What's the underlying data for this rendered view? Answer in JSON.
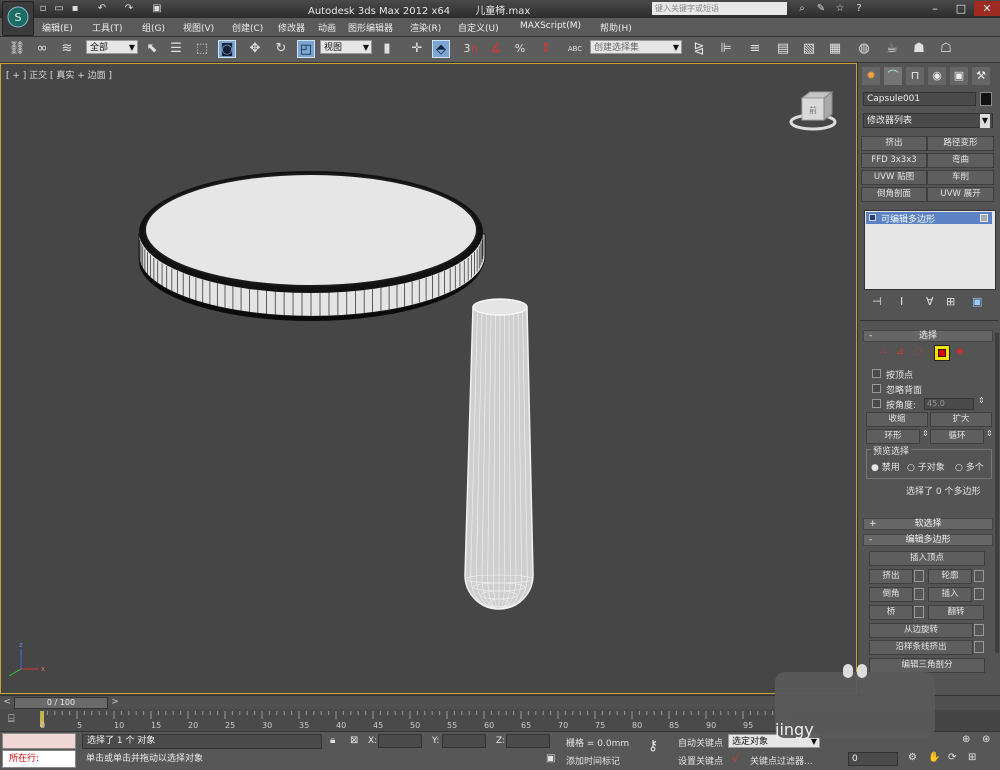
{
  "title_bar": {
    "app": "Autodesk 3ds Max  2012 x64",
    "file": "儿童椅.max",
    "search_placeholder": "键入关键字或短语"
  },
  "menu": [
    "编辑(E)",
    "工具(T)",
    "组(G)",
    "视图(V)",
    "创建(C)",
    "修改器",
    "动画",
    "图形编辑器",
    "渲染(R)",
    "自定义(U)",
    "MAXScript(M)",
    "帮助(H)"
  ],
  "toolbar": {
    "selection_filter": "全部",
    "reference_coord": "视图",
    "named_selection": "创建选择集",
    "snap_labels": [
      "3",
      "%",
      "ABC"
    ]
  },
  "viewport": {
    "label": "[ + ] 正交  [ 真实 + 边面 ]",
    "nav_cube_label": "前"
  },
  "panel": {
    "object_name": "Capsule001",
    "modifier_list": "修改器列表",
    "quick_modifiers": [
      "挤出",
      "路径变形",
      "FFD 3x3x3",
      "弯曲",
      "UVW 贴图",
      "车削",
      "倒角剖面",
      "UVW 展开"
    ],
    "stack_item": "可编辑多边形",
    "selection_rollout": "选择",
    "by_vertex": "按顶点",
    "ignore_backfacing": "忽略背面",
    "by_angle": "按角度:",
    "angle_value": "45.0",
    "shrink": "收缩",
    "grow": "扩大",
    "ring": "环形",
    "loop": "循环",
    "preview_group": "预览选择",
    "preview_options": [
      "禁用",
      "子对象",
      "多个"
    ],
    "selection_status": "选择了 0 个多边形",
    "soft_selection": "软选择",
    "edit_polygons": "编辑多边形",
    "insert_vertex": "插入顶点",
    "edit_buttons": [
      "挤出",
      "轮廓",
      "倒角",
      "插入",
      "桥",
      "翻转"
    ],
    "hinge": "从边旋转",
    "extrude_spline": "沿样条线挤出",
    "edit_triangulation": "编辑三角剖分"
  },
  "timeline": {
    "frame": "0 / 100",
    "ticks": [
      "0",
      "5",
      "10",
      "15",
      "20",
      "25",
      "30",
      "35",
      "40",
      "45",
      "50",
      "55",
      "60",
      "65",
      "70",
      "75",
      "80",
      "85",
      "90",
      "95"
    ]
  },
  "status": {
    "running": "所在行:",
    "selected": "选择了 1 个 对象",
    "prompt": "单击或单击并拖动以选择对象",
    "x_label": "X:",
    "y_label": "Y:",
    "z_label": "Z:",
    "grid": "栅格 = 0.0mm",
    "add_time_tag": "添加时间标记",
    "auto_key": "自动关键点",
    "set_key": "设置关键点",
    "selected_object": "选定对象",
    "key_filters": "关键点过滤器...",
    "frame_value": "0",
    "watermark": "jingy"
  }
}
